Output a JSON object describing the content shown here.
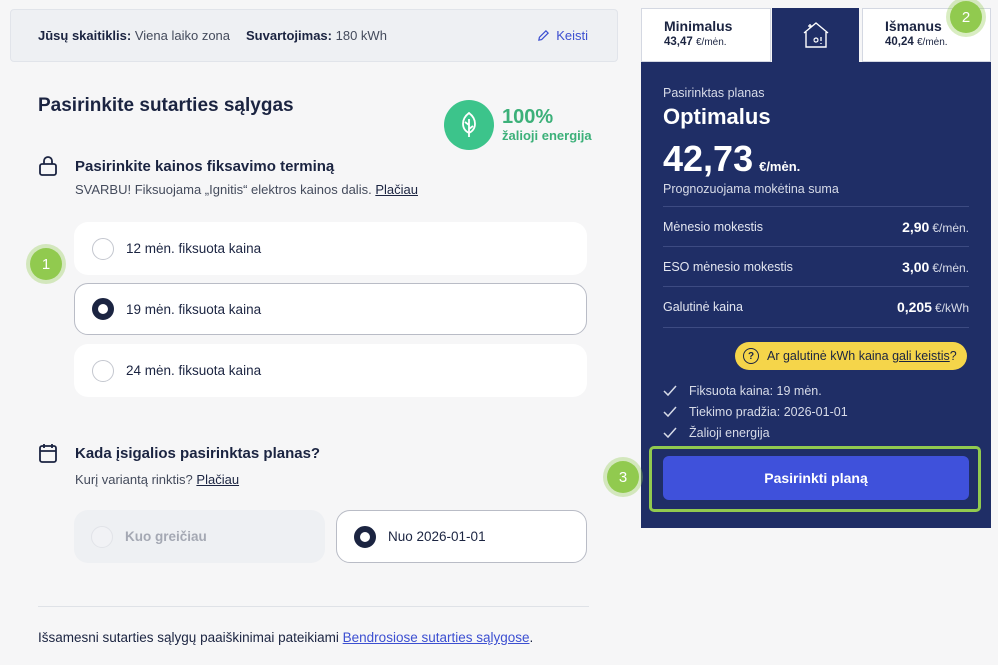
{
  "topbar": {
    "meter_label": "Jūsų skaitiklis:",
    "meter_value": "Viena laiko zona",
    "consumption_label": "Suvartojimas:",
    "consumption_value": "180 kWh",
    "edit_label": "Keisti"
  },
  "title": "Pasirinkite sutarties sąlygas",
  "green": {
    "percent": "100%",
    "label": "žalioji energija",
    "color": "#3cc48b"
  },
  "fixation": {
    "heading": "Pasirinkite kainos fiksavimo terminą",
    "note": "SVARBU! Fiksuojama „Ignitis“ elektros kainos dalis.",
    "more": "Plačiau",
    "options": [
      {
        "label": "12 mėn. fiksuota kaina",
        "selected": false
      },
      {
        "label": "19 mėn. fiksuota kaina",
        "selected": true
      },
      {
        "label": "24 mėn. fiksuota kaina",
        "selected": false
      }
    ]
  },
  "start": {
    "heading": "Kada įsigalios pasirinktas planas?",
    "note": "Kurį variantą rinktis?",
    "more": "Plačiau",
    "options": [
      {
        "label": "Kuo greičiau",
        "disabled": true
      },
      {
        "label": "Nuo 2026-01-01",
        "selected": true
      }
    ]
  },
  "footer": {
    "text": "Išsamesni sutarties sąlygų paaiškinimai pateikiami",
    "link": "Bendrosiose sutarties sąlygose",
    "end": "."
  },
  "markers": [
    "1",
    "2",
    "3"
  ],
  "tabs": [
    {
      "name": "Minimalus",
      "price": "43,47",
      "unit": "€/mėn."
    },
    {
      "name": "Išmanus",
      "price": "40,24",
      "unit": "€/mėn."
    }
  ],
  "plan": {
    "label": "Pasirinktas planas",
    "name": "Optimalus",
    "price": "42,73",
    "price_unit": "€/mėn.",
    "price_sub": "Prognozuojama mokėtina suma",
    "fees": [
      {
        "label": "Mėnesio mokestis",
        "value": "2,90",
        "unit": "€/mėn."
      },
      {
        "label": "ESO mėnesio mokestis",
        "value": "3,00",
        "unit": "€/mėn."
      },
      {
        "label": "Galutinė kaina",
        "value": "0,205",
        "unit": "€/kWh"
      }
    ],
    "tip_text": "Ar galutinė kWh kaina",
    "tip_link": "gali keistis",
    "tip_end": "?",
    "checks": [
      "Fiksuota kaina: 19 mėn.",
      "Tiekimo pradžia: 2026-01-01",
      "Žalioji energija"
    ],
    "select_button": "Pasirinkti planą"
  },
  "colors": {
    "navy": "#1f2e66",
    "accent": "#3f51db",
    "marker": "#91ca4f",
    "tip": "#f5d54a"
  }
}
